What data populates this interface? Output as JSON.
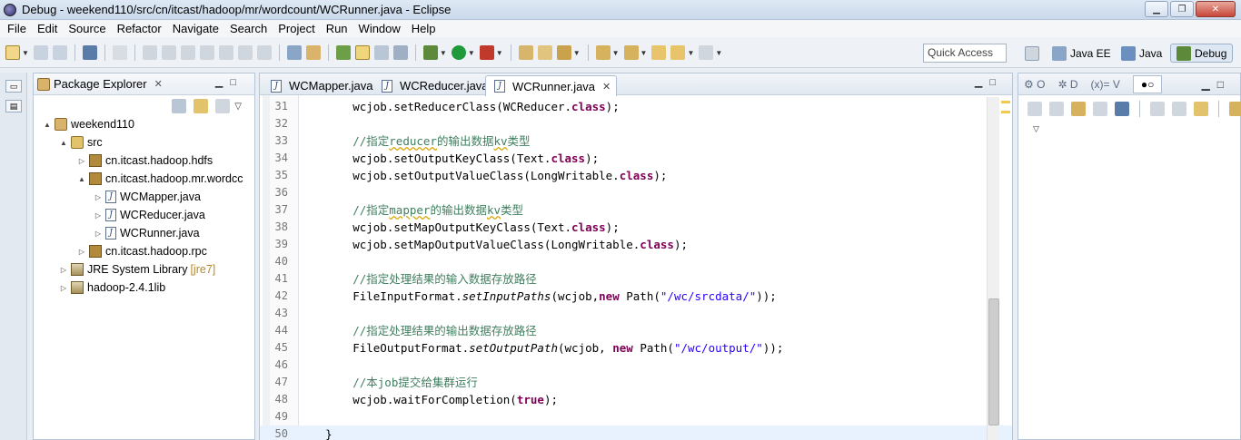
{
  "window": {
    "title": "Debug - weekend110/src/cn/itcast/hadoop/mr/wordcount/WCRunner.java - Eclipse"
  },
  "menu": [
    "File",
    "Edit",
    "Source",
    "Refactor",
    "Navigate",
    "Search",
    "Project",
    "Run",
    "Window",
    "Help"
  ],
  "toolbar": {
    "quick_access_placeholder": "Quick Access",
    "perspectives": [
      {
        "label": "Java EE",
        "active": false
      },
      {
        "label": "Java",
        "active": false
      },
      {
        "label": "Debug",
        "active": true
      }
    ]
  },
  "package_explorer": {
    "title": "Package Explorer",
    "tree": [
      {
        "label": "weekend110",
        "icon": "project-icon",
        "depth": 0,
        "twist": "▲"
      },
      {
        "label": "src",
        "icon": "source-folder-icon",
        "depth": 1,
        "twist": "▲"
      },
      {
        "label": "cn.itcast.hadoop.hdfs",
        "icon": "package-icon",
        "depth": 2,
        "twist": "▷"
      },
      {
        "label": "cn.itcast.hadoop.mr.wordcc",
        "icon": "package-icon",
        "depth": 2,
        "twist": "▲"
      },
      {
        "label": "WCMapper.java",
        "icon": "java-file-icon",
        "depth": 3,
        "twist": "▷"
      },
      {
        "label": "WCReducer.java",
        "icon": "java-file-icon",
        "depth": 3,
        "twist": "▷"
      },
      {
        "label": "WCRunner.java",
        "icon": "java-file-icon",
        "depth": 3,
        "twist": "▷"
      },
      {
        "label": "cn.itcast.hadoop.rpc",
        "icon": "package-icon",
        "depth": 2,
        "twist": "▷"
      },
      {
        "label": "JRE System Library",
        "decoration": "[jre7]",
        "icon": "library-icon",
        "depth": 1,
        "twist": "▷"
      },
      {
        "label": "hadoop-2.4.1lib",
        "icon": "library-icon",
        "depth": 1,
        "twist": "▷"
      }
    ]
  },
  "editor": {
    "tabs": [
      {
        "label": "WCMapper.java",
        "active": false
      },
      {
        "label": "WCReducer.java",
        "active": false
      },
      {
        "label": "WCRunner.java",
        "active": true
      }
    ],
    "lines": [
      {
        "num": "31",
        "html": "        wcjob.setReducerClass(WCReducer.<span class=\"kw\">class</span>);"
      },
      {
        "num": "32",
        "html": ""
      },
      {
        "num": "33",
        "html": "        <span class=\"cm\">//指定<span class=\"sq\">reducer</span>的输出数据<span class=\"sq\">kv</span>类型</span>"
      },
      {
        "num": "34",
        "html": "        wcjob.setOutputKeyClass(Text.<span class=\"kw\">class</span>);"
      },
      {
        "num": "35",
        "html": "        wcjob.setOutputValueClass(LongWritable.<span class=\"kw\">class</span>);"
      },
      {
        "num": "36",
        "html": ""
      },
      {
        "num": "37",
        "html": "        <span class=\"cm\">//指定<span class=\"sq\">mapper</span>的输出数据<span class=\"sq\">kv</span>类型</span>"
      },
      {
        "num": "38",
        "html": "        wcjob.setMapOutputKeyClass(Text.<span class=\"kw\">class</span>);"
      },
      {
        "num": "39",
        "html": "        wcjob.setMapOutputValueClass(LongWritable.<span class=\"kw\">class</span>);"
      },
      {
        "num": "40",
        "html": ""
      },
      {
        "num": "41",
        "html": "        <span class=\"cm\">//指定处理结果的输入数据存放路径</span>"
      },
      {
        "num": "42",
        "html": "        FileInputFormat.<span class=\"it\">setInputPaths</span>(wcjob,<span class=\"kw\">new</span> Path(<span class=\"st\">\"/wc/srcdata/\"</span>));"
      },
      {
        "num": "43",
        "html": ""
      },
      {
        "num": "44",
        "html": "        <span class=\"cm\">//指定处理结果的输出数据存放路径</span>"
      },
      {
        "num": "45",
        "html": "        FileOutputFormat.<span class=\"it\">setOutputPath</span>(wcjob, <span class=\"kw\">new</span> Path(<span class=\"st\">\"/wc/output/\"</span>));"
      },
      {
        "num": "46",
        "html": ""
      },
      {
        "num": "47",
        "html": "        <span class=\"cm\">//本job提交给集群运行</span>"
      },
      {
        "num": "48",
        "html": "        wcjob.waitForCompletion(<span class=\"kw\">true</span>);"
      },
      {
        "num": "49",
        "html": ""
      },
      {
        "num": "50",
        "html": "    }"
      }
    ]
  },
  "right_panel": {
    "tabs": [
      "O",
      "D",
      "V",
      ""
    ]
  }
}
